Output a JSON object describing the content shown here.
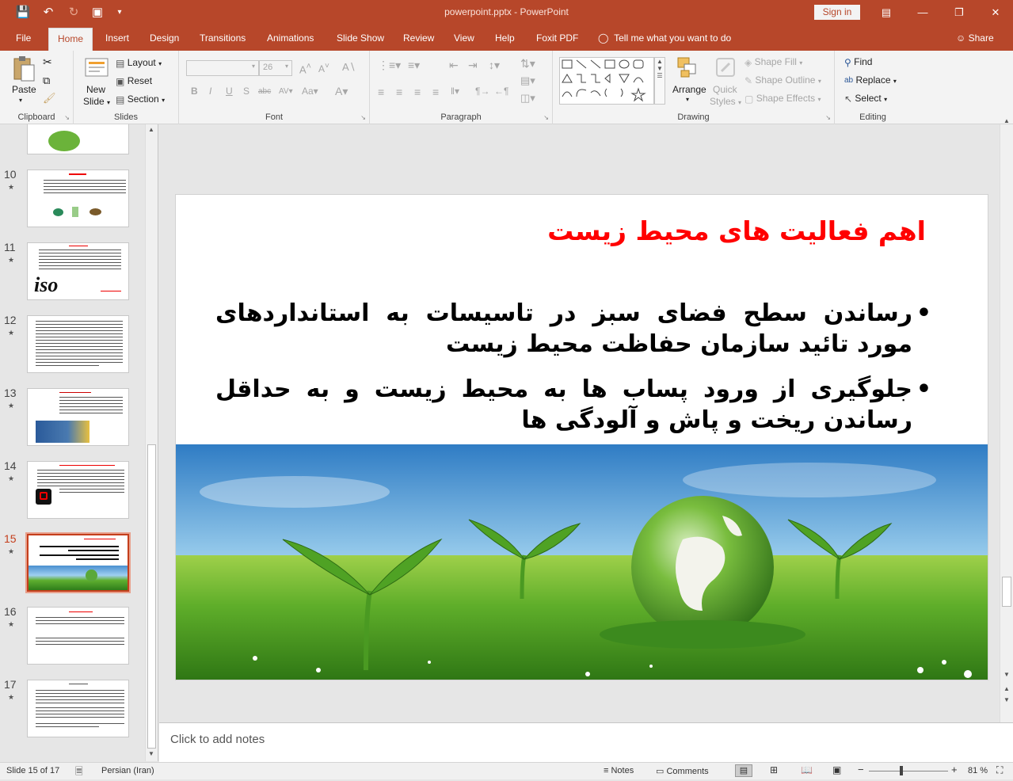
{
  "window": {
    "title": "powerpoint.pptx - PowerPoint",
    "signin": "Sign in"
  },
  "tabs": [
    {
      "label": "File"
    },
    {
      "label": "Home"
    },
    {
      "label": "Insert"
    },
    {
      "label": "Design"
    },
    {
      "label": "Transitions"
    },
    {
      "label": "Animations"
    },
    {
      "label": "Slide Show"
    },
    {
      "label": "Review"
    },
    {
      "label": "View"
    },
    {
      "label": "Help"
    },
    {
      "label": "Foxit PDF"
    }
  ],
  "tell_me": "Tell me what you want to do",
  "share": "Share",
  "ribbon": {
    "clipboard": {
      "label": "Clipboard",
      "paste": "Paste"
    },
    "slides": {
      "label": "Slides",
      "new_slide": "New",
      "new_slide2": "Slide",
      "layout": "Layout",
      "reset": "Reset",
      "section": "Section"
    },
    "font": {
      "label": "Font",
      "size": "26"
    },
    "paragraph": {
      "label": "Paragraph"
    },
    "drawing": {
      "label": "Drawing",
      "arrange": "Arrange",
      "quick_styles": "Quick",
      "quick_styles2": "Styles",
      "shape_fill": "Shape Fill",
      "shape_outline": "Shape Outline",
      "shape_effects": "Shape Effects"
    },
    "editing": {
      "label": "Editing",
      "find": "Find",
      "replace": "Replace",
      "select": "Select"
    }
  },
  "thumbnails": [
    {
      "num": "10"
    },
    {
      "num": "11"
    },
    {
      "num": "12"
    },
    {
      "num": "13"
    },
    {
      "num": "14"
    },
    {
      "num": "15"
    },
    {
      "num": "16"
    },
    {
      "num": "17"
    }
  ],
  "slide": {
    "title": "اهم فعالیت های محیط زیست",
    "bullets": [
      "رساندن سطح فضای سبز در تاسیسات به استانداردهای مورد تائید سازمان حفاظت محیط زیست",
      "جلوگیری از ورود پساب ها به محیط زیست و به حداقل رساندن ریخت و پاش و آلودگی ها"
    ]
  },
  "notes_placeholder": "Click to add notes",
  "status": {
    "slide_info": "Slide 15 of 17",
    "language": "Persian (Iran)",
    "notes": "Notes",
    "comments": "Comments",
    "zoom": "81 %",
    "zoom_fraction": 0.81
  },
  "colors": {
    "accent": "#b7472a",
    "slide_title": "#ff0000"
  }
}
